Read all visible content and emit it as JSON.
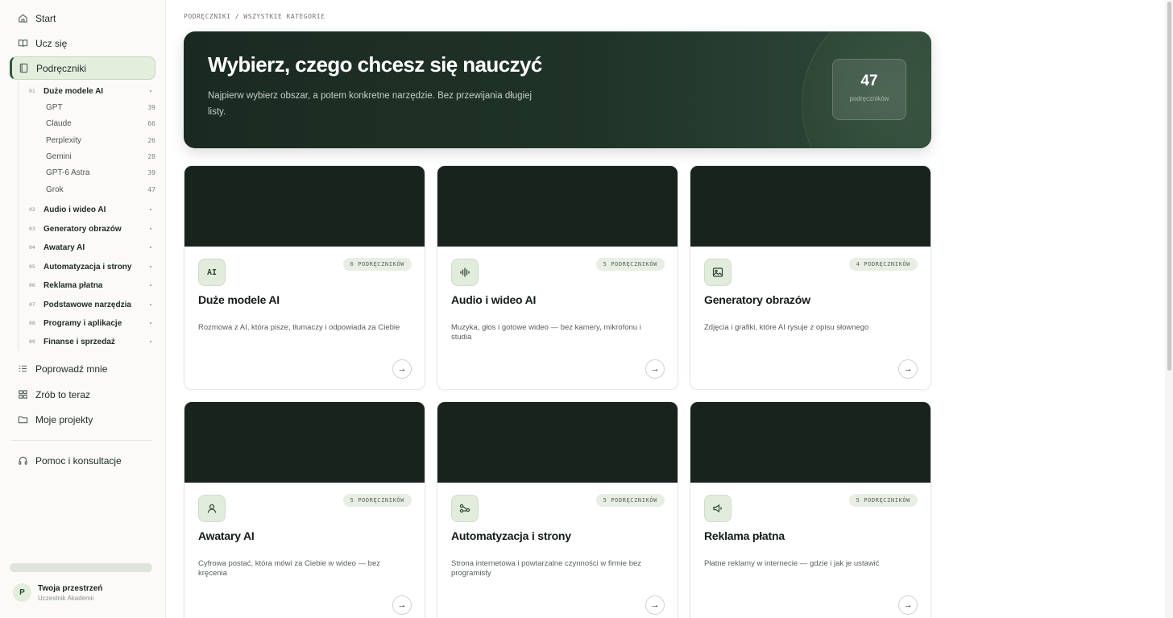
{
  "sidebar": {
    "nav_top": [
      {
        "label": "Start",
        "icon": "home-icon"
      },
      {
        "label": "Ucz się",
        "icon": "book-open-icon"
      },
      {
        "label": "Podręczniki",
        "icon": "book-icon",
        "active": true
      }
    ],
    "categories": [
      {
        "num": "01",
        "label": "Duże modele AI"
      },
      {
        "num": "02",
        "label": "Audio i wideo AI"
      },
      {
        "num": "03",
        "label": "Generatory obrazów"
      },
      {
        "num": "04",
        "label": "Awatary AI"
      },
      {
        "num": "05",
        "label": "Automatyzacja i strony"
      },
      {
        "num": "06",
        "label": "Reklama płatna"
      },
      {
        "num": "07",
        "label": "Podstawowe narzędzia"
      },
      {
        "num": "08",
        "label": "Programy i aplikacje"
      },
      {
        "num": "09",
        "label": "Finanse i sprzedaż"
      }
    ],
    "subitems": [
      {
        "label": "GPT",
        "count": "39"
      },
      {
        "label": "Claude",
        "count": "66"
      },
      {
        "label": "Perplexity",
        "count": "26"
      },
      {
        "label": "Gemini",
        "count": "28"
      },
      {
        "label": "GPT-6 Astra",
        "count": "39"
      },
      {
        "label": "Grok",
        "count": "47"
      }
    ],
    "nav_bottom": [
      {
        "label": "Poprowadź mnie",
        "icon": "list-icon"
      },
      {
        "label": "Zrób to teraz",
        "icon": "grid-icon"
      },
      {
        "label": "Moje projekty",
        "icon": "folder-icon"
      }
    ],
    "help": {
      "label": "Pomoc i konsultacje",
      "icon": "headphones-icon"
    },
    "profile": {
      "initial": "P",
      "name": "Twoja przestrzeń",
      "role": "Uczestnik Akademii"
    }
  },
  "breadcrumb": "PODRĘCZNIKI / WSZYSTKIE KATEGORIE",
  "hero": {
    "title": "Wybierz, czego chcesz się nauczyć",
    "subtitle": "Najpierw wybierz obszar, a potem konkretne narzędzie. Bez przewijania długiej listy.",
    "stat_value": "47",
    "stat_label": "podręczników"
  },
  "cards": [
    {
      "icon": "ai-text-icon",
      "icon_text": "AI",
      "badge": "6 PODRĘCZNIKÓW",
      "title": "Duże modele AI",
      "desc": "Rozmowa z AI, która pisze, tłumaczy i odpowiada za Ciebie"
    },
    {
      "icon": "audio-wave-icon",
      "badge": "5 PODRĘCZNIKÓW",
      "title": "Audio i wideo AI",
      "desc": "Muzyka, głos i gotowe wideo — bez kamery, mikrofonu i studia"
    },
    {
      "icon": "image-icon",
      "badge": "4 PODRĘCZNIKÓW",
      "title": "Generatory obrazów",
      "desc": "Zdjęcia i grafiki, które AI rysuje z opisu słownego"
    },
    {
      "icon": "user-icon",
      "badge": "5 PODRĘCZNIKÓW",
      "title": "Awatary AI",
      "desc": "Cyfrowa postać, która mówi za Ciebie w wideo — bez kręcenia"
    },
    {
      "icon": "workflow-icon",
      "badge": "5 PODRĘCZNIKÓW",
      "title": "Automatyzacja i strony",
      "desc": "Strona internetowa i powtarzalne czynności w firmie bez programisty"
    },
    {
      "icon": "megaphone-icon",
      "badge": "5 PODRĘCZNIKÓW",
      "title": "Reklama płatna",
      "desc": "Płatne reklamy w internecie — gdzie i jak je ustawić"
    }
  ]
}
